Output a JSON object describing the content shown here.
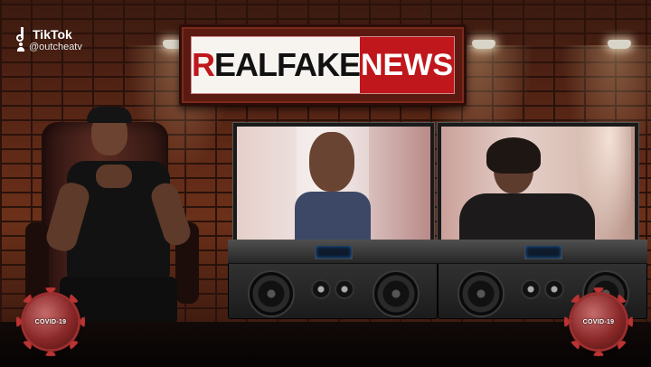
{
  "overlay": {
    "brand": "TikTok",
    "handle": "@outcheatv"
  },
  "sign": {
    "word_real_first": "R",
    "word_real_rest": "EALFAKE",
    "word_news": "NEWS",
    "colors": {
      "red": "#c0171c",
      "frame": "#5a1a12",
      "panel": "#f7f3ef"
    }
  },
  "virus_badges": [
    {
      "label": "COVID-19"
    },
    {
      "label": "COVID-19"
    }
  ],
  "icons": [
    "tiktok-logo-icon",
    "user-icon",
    "virus-icon"
  ]
}
